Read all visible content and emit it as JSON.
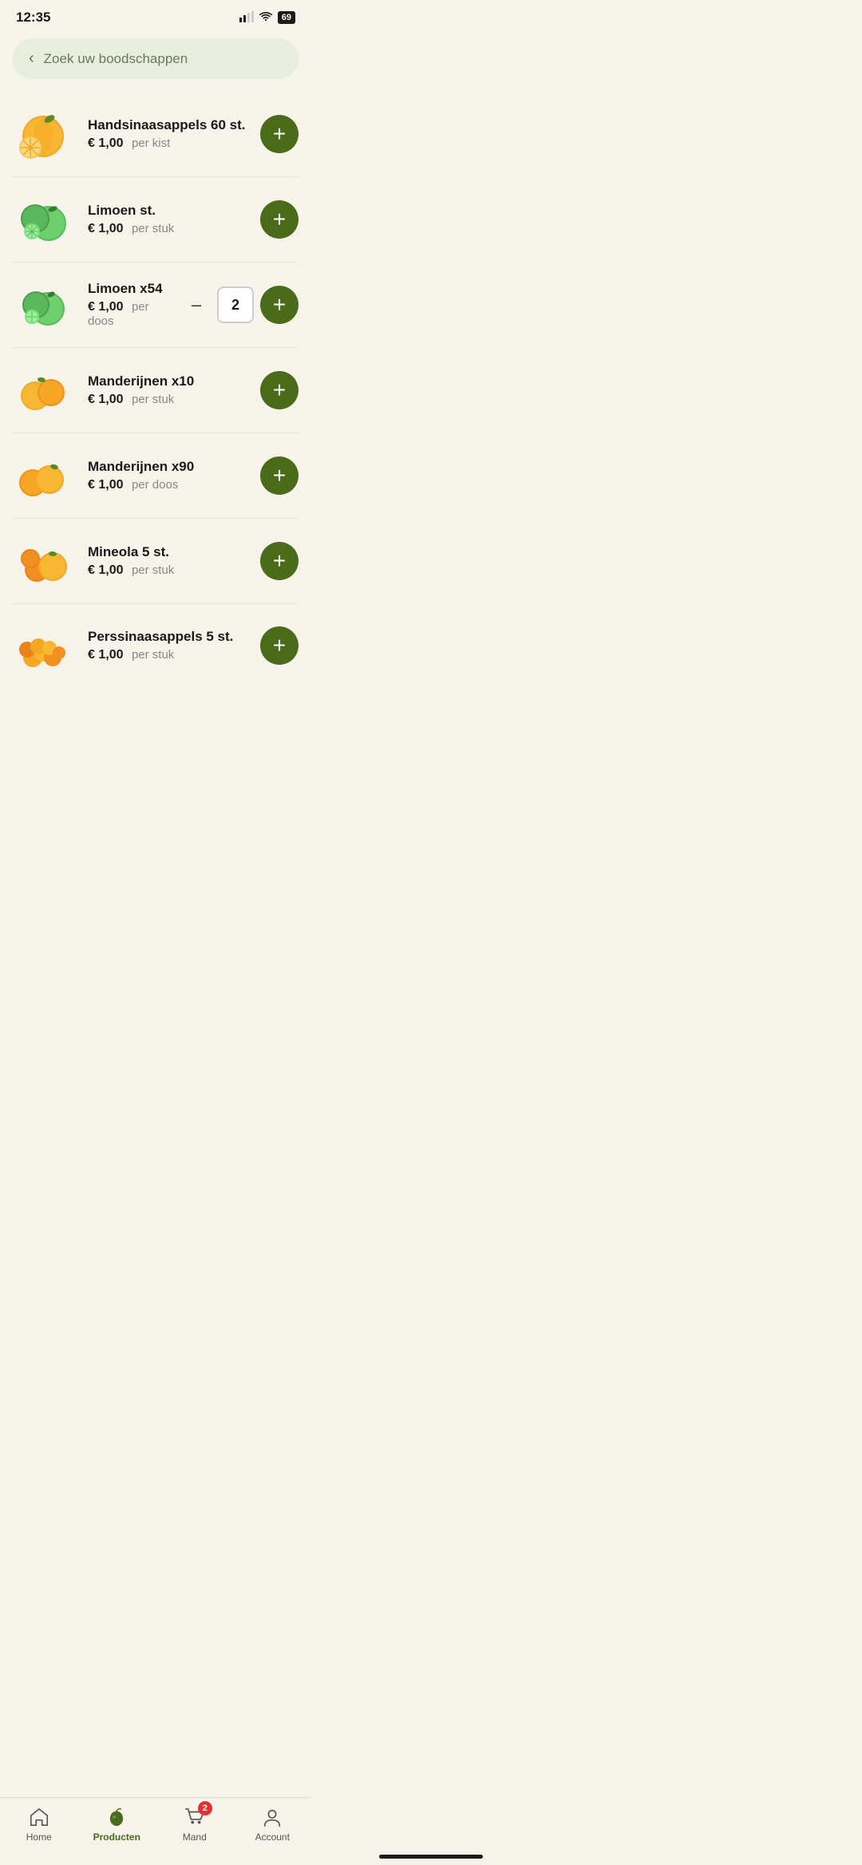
{
  "statusBar": {
    "time": "12:35",
    "battery": "69"
  },
  "search": {
    "placeholder": "Zoek uw boodschappen"
  },
  "products": [
    {
      "id": 1,
      "name": "Handsinaasappels 60 st.",
      "price": "€ 1,00",
      "unit": "per kist",
      "emoji": "🍊",
      "hasQuantity": false,
      "quantity": 0
    },
    {
      "id": 2,
      "name": "Limoen st.",
      "price": "€ 1,00",
      "unit": "per stuk",
      "emoji": "🍋",
      "hasQuantity": false,
      "quantity": 0
    },
    {
      "id": 3,
      "name": "Limoen x54",
      "price": "€ 1,00",
      "unit": "per doos",
      "emoji": "🍋",
      "hasQuantity": true,
      "quantity": 2
    },
    {
      "id": 4,
      "name": "Manderijnen x10",
      "price": "€ 1,00",
      "unit": "per stuk",
      "emoji": "🍊",
      "hasQuantity": false,
      "quantity": 0
    },
    {
      "id": 5,
      "name": "Manderijnen x90",
      "price": "€ 1,00",
      "unit": "per doos",
      "emoji": "🍊",
      "hasQuantity": false,
      "quantity": 0
    },
    {
      "id": 6,
      "name": "Mineola 5 st.",
      "price": "€ 1,00",
      "unit": "per stuk",
      "emoji": "🍊",
      "hasQuantity": false,
      "quantity": 0
    },
    {
      "id": 7,
      "name": "Perssinaasappels 5 st.",
      "price": "€ 1,00",
      "unit": "per stuk",
      "emoji": "🍊",
      "hasQuantity": false,
      "quantity": 0,
      "partial": true
    }
  ],
  "bottomNav": {
    "items": [
      {
        "id": "home",
        "label": "Home",
        "active": false
      },
      {
        "id": "producten",
        "label": "Producten",
        "active": true
      },
      {
        "id": "mand",
        "label": "Mand",
        "active": false,
        "badge": "2"
      },
      {
        "id": "account",
        "label": "Account",
        "active": false
      }
    ]
  }
}
